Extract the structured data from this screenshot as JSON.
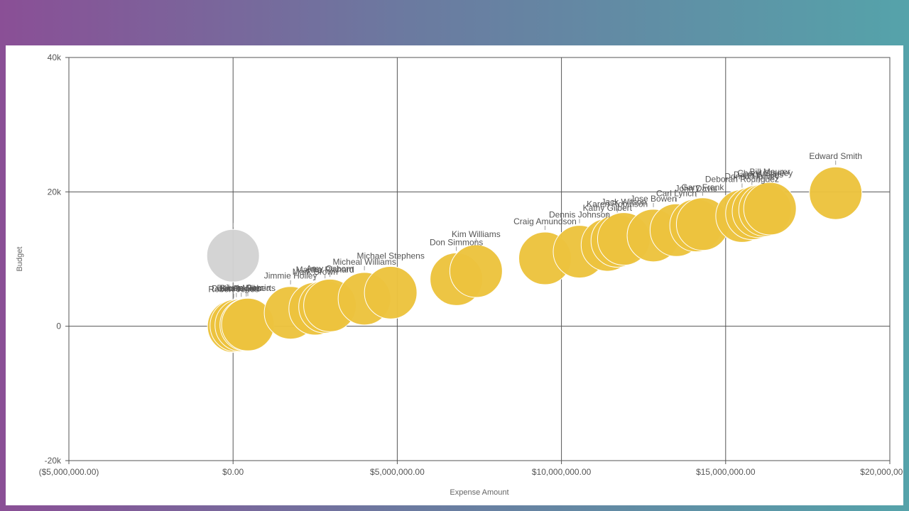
{
  "chart_data": {
    "type": "scatter",
    "title": "",
    "xlabel": "Expense Amount",
    "ylabel": "Budget",
    "xlim": [
      -5000000,
      20000000
    ],
    "ylim": [
      -20000,
      40000
    ],
    "x_ticks": [
      {
        "value": -5000000,
        "label": "($5,000,000.00)"
      },
      {
        "value": 0,
        "label": "$0.00"
      },
      {
        "value": 5000000,
        "label": "$5,000,000.00"
      },
      {
        "value": 10000000,
        "label": "$10,000,000.00"
      },
      {
        "value": 15000000,
        "label": "$15,000,000.00"
      },
      {
        "value": 20000000,
        "label": "$20,000,000.00"
      }
    ],
    "y_ticks": [
      {
        "value": -20000,
        "label": "-20k"
      },
      {
        "value": 0,
        "label": "0"
      },
      {
        "value": 20000,
        "label": "20k"
      },
      {
        "value": 40000,
        "label": "40k"
      }
    ],
    "grid": true,
    "legend": "none",
    "colors": {
      "primary": "#ecc33e",
      "secondary": "#d3d3d3",
      "label": "#555555",
      "grid": "#555555"
    },
    "series": [
      {
        "points": [
          {
            "x": 0,
            "y": 10500,
            "label": "",
            "color": "secondary"
          },
          {
            "x": 20000,
            "y": 0,
            "label": "Robert Jones"
          },
          {
            "x": 100000,
            "y": 100,
            "label": "Dalia Rogers"
          },
          {
            "x": 250000,
            "y": 150,
            "label": "Brian Miller"
          },
          {
            "x": 400000,
            "y": 200,
            "label": "Dennis Roberts"
          },
          {
            "x": 450000,
            "y": 250,
            "label": "Juan Garcia"
          },
          {
            "x": 1750000,
            "y": 2000,
            "label": "Jimmie Holley"
          },
          {
            "x": 2500000,
            "y": 2600,
            "label": "Mark Brown"
          },
          {
            "x": 2800000,
            "y": 2900,
            "label": "Martha Richard"
          },
          {
            "x": 2950000,
            "y": 3100,
            "label": "Amy Osborn"
          },
          {
            "x": 4000000,
            "y": 4100,
            "label": "Micheal Williams"
          },
          {
            "x": 4800000,
            "y": 5000,
            "label": "Michael Stephens"
          },
          {
            "x": 6800000,
            "y": 7000,
            "label": "Don Simmons"
          },
          {
            "x": 7400000,
            "y": 8200,
            "label": "Kim Williams"
          },
          {
            "x": 9500000,
            "y": 10100,
            "label": "Craig Amundson"
          },
          {
            "x": 10550000,
            "y": 11100,
            "label": "Dennis Johnson"
          },
          {
            "x": 11400000,
            "y": 12100,
            "label": "Kathy Gilbert"
          },
          {
            "x": 11700000,
            "y": 12700,
            "label": "Karen Robinson"
          },
          {
            "x": 11900000,
            "y": 13000,
            "label": "Jack Wilson"
          },
          {
            "x": 12800000,
            "y": 13500,
            "label": "Jose Bowen"
          },
          {
            "x": 13500000,
            "y": 14300,
            "label": "Carl Lynch"
          },
          {
            "x": 14100000,
            "y": 15000,
            "label": "John Davis"
          },
          {
            "x": 14300000,
            "y": 15200,
            "label": "Gary Frank"
          },
          {
            "x": 15500000,
            "y": 16400,
            "label": "Deborah Rodriguez"
          },
          {
            "x": 15800000,
            "y": 16800,
            "label": "Donna Harvey"
          },
          {
            "x": 16000000,
            "y": 17100,
            "label": "Dana Wilkins"
          },
          {
            "x": 16200000,
            "y": 17300,
            "label": "Cheryl Stanley"
          },
          {
            "x": 16350000,
            "y": 17500,
            "label": "Bill Maurer"
          },
          {
            "x": 18350000,
            "y": 19800,
            "label": "Edward Smith"
          }
        ]
      }
    ]
  }
}
